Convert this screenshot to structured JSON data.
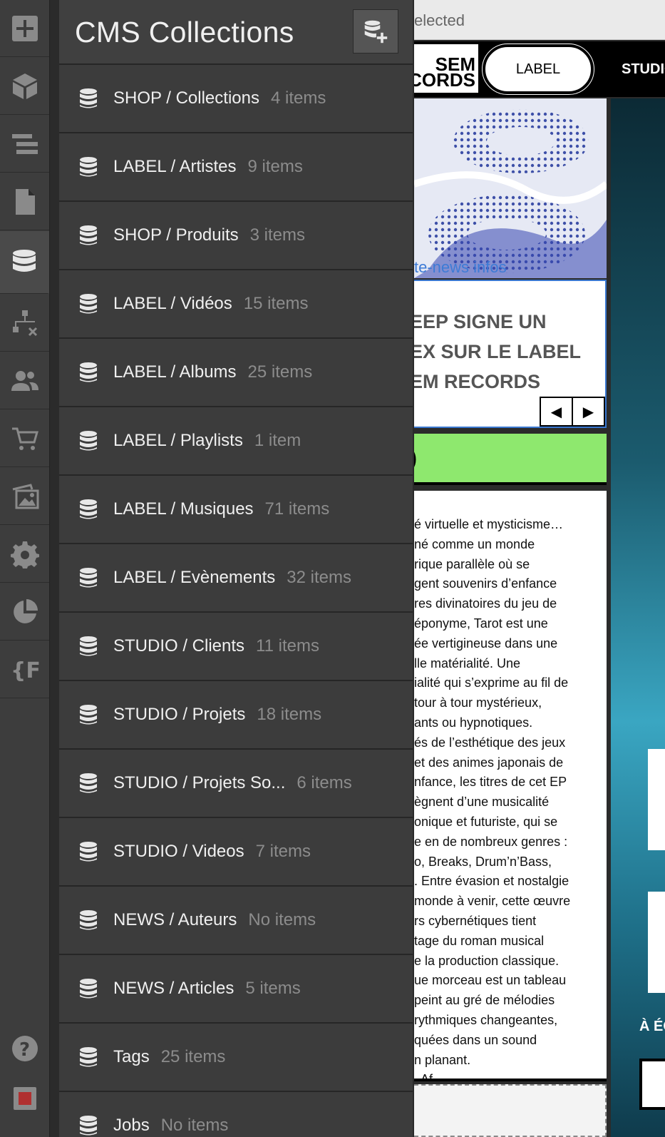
{
  "panel": {
    "title": "CMS Collections",
    "items": [
      {
        "name": "SHOP / Collections",
        "count": "4 items"
      },
      {
        "name": "LABEL / Artistes",
        "count": "9 items"
      },
      {
        "name": "SHOP / Produits",
        "count": "3 items"
      },
      {
        "name": "LABEL / Vidéos",
        "count": "15 items"
      },
      {
        "name": "LABEL / Albums",
        "count": "25 items"
      },
      {
        "name": "LABEL / Playlists",
        "count": "1 item"
      },
      {
        "name": "LABEL / Musiques",
        "count": "71 items"
      },
      {
        "name": "LABEL / Evènements",
        "count": "32 items"
      },
      {
        "name": "STUDIO / Clients",
        "count": "11 items"
      },
      {
        "name": "STUDIO / Projets",
        "count": "18 items"
      },
      {
        "name": "STUDIO / Projets So...",
        "count": "6 items"
      },
      {
        "name": "STUDIO / Videos",
        "count": "7 items"
      },
      {
        "name": "NEWS / Auteurs",
        "count": "No items"
      },
      {
        "name": "NEWS / Articles",
        "count": "5 items"
      },
      {
        "name": "Tags",
        "count": "25 items"
      },
      {
        "name": "Jobs",
        "count": "No items"
      }
    ]
  },
  "rail": {
    "icons": [
      "add-icon",
      "cube-icon",
      "navigator-icon",
      "page-icon",
      "database-icon",
      "logic-icon",
      "users-icon",
      "cart-icon",
      "assets-icon",
      "settings-icon",
      "apps-icon",
      "fonts-icon",
      "help-icon",
      "record-icon"
    ]
  },
  "preview": {
    "topbar_text": "elected",
    "logo_line1": "SEM",
    "logo_line2": "CORDS",
    "nav_label": "LABEL",
    "nav_studio": "STUDIO",
    "art_link": "te-news infos",
    "card_title": "EEP SIGNE UN\nEX SUR LE LABEL\nEM RECORDS",
    "green_text": ")",
    "hero_label": "À ÉC",
    "body_text": "é virtuelle et mysticisme…\nné comme un monde\nrique parallèle où se\ngent souvenirs d’enfance\nres divinatoires du jeu de\néponyme, Tarot est une\née vertigineuse dans une\nlle matérialité. Une\nialité qui s’exprime au fil de\ntour à tour mystérieux,\nants ou hypnotiques.\nés de l’esthétique des jeux\net des animes japonais de\nnfance, les titres de cet EP\nègnent d’une musicalité\nonique et futuriste, qui se\ne en de nombreux genres :\no, Breaks, Drum’n’Bass,\n. Entre évasion et nostalgie\nmonde à venir, cette œuvre\nrs cybernétiques tient\ntage du roman musical\ne la production classique.\nue morceau est un tableau\npeint au gré de mélodies\nrythmiques changeantes,\nquées dans un sound\nn planant.\n. Af"
  },
  "colors": {
    "panel_bg": "#3c3c3c",
    "rail_bg": "#3d3d3d",
    "accent_green": "#8ee86e",
    "link_blue": "#3d7bd6"
  }
}
